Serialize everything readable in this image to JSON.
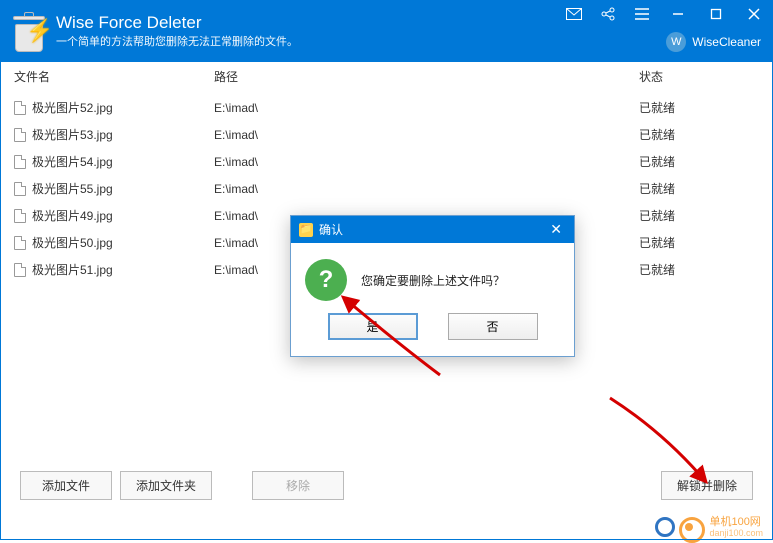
{
  "app": {
    "title": "Wise Force Deleter",
    "subtitle": "一个简单的方法帮助您删除无法正常删除的文件。",
    "brand": "WiseCleaner",
    "brand_badge": "W"
  },
  "columns": {
    "name": "文件名",
    "path": "路径",
    "status": "状态"
  },
  "files": [
    {
      "name": "极光图片52.jpg",
      "path": "E:\\imad\\",
      "status": "已就绪"
    },
    {
      "name": "极光图片53.jpg",
      "path": "E:\\imad\\",
      "status": "已就绪"
    },
    {
      "name": "极光图片54.jpg",
      "path": "E:\\imad\\",
      "status": "已就绪"
    },
    {
      "name": "极光图片55.jpg",
      "path": "E:\\imad\\",
      "status": "已就绪"
    },
    {
      "name": "极光图片49.jpg",
      "path": "E:\\imad\\",
      "status": "已就绪"
    },
    {
      "name": "极光图片50.jpg",
      "path": "E:\\imad\\",
      "status": "已就绪"
    },
    {
      "name": "极光图片51.jpg",
      "path": "E:\\imad\\",
      "status": "已就绪"
    }
  ],
  "buttons": {
    "add_file": "添加文件",
    "add_folder": "添加文件夹",
    "remove": "移除",
    "unlock_delete": "解锁并删除"
  },
  "dialog": {
    "title": "确认",
    "message": "您确定要删除上述文件吗？",
    "yes": "是",
    "no": "否"
  },
  "watermark": {
    "line1": "单机100网",
    "line2": "danji100.com"
  }
}
